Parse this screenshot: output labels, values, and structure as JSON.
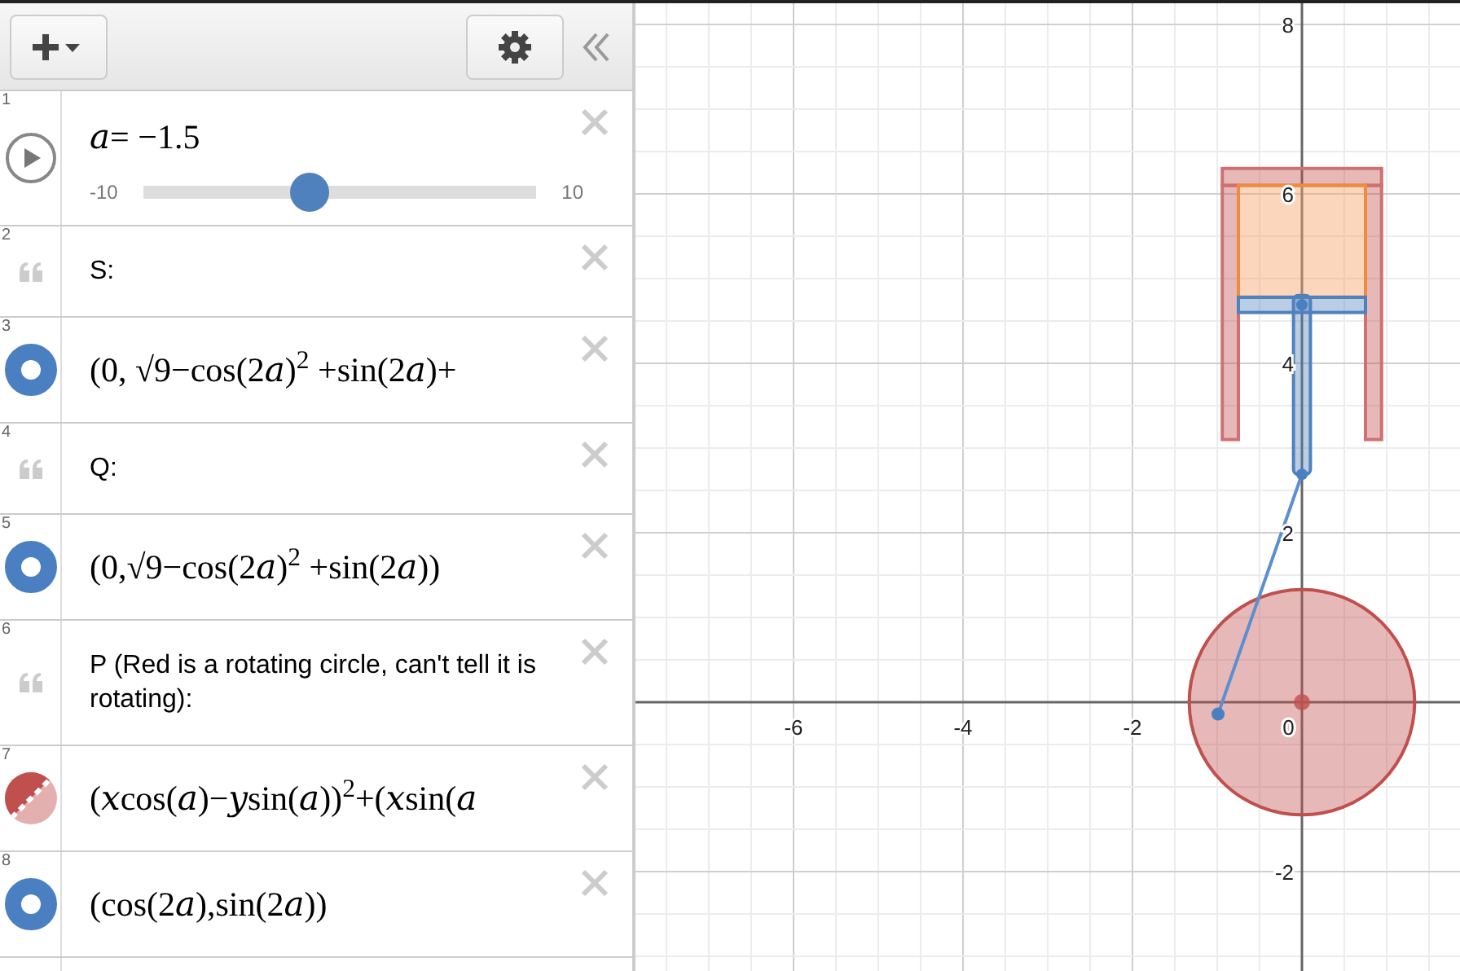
{
  "expressions": [
    {
      "number": "1",
      "kind": "slider",
      "latex": "𝑎= −1.5",
      "min": "-10",
      "max": "10",
      "level": 0.425
    },
    {
      "number": "2",
      "kind": "note",
      "text": "S:"
    },
    {
      "number": "3",
      "kind": "point",
      "color": "#4a7fc1",
      "latex": "(0, √9−cos(2𝑎)$^{2}$ +sin(2𝑎)+"
    },
    {
      "number": "4",
      "kind": "note",
      "text": "Q:"
    },
    {
      "number": "5",
      "kind": "point",
      "color": "#4a7fc1",
      "latex": "(0,√9−cos(2𝑎)$^{2}$ +sin(2𝑎))"
    },
    {
      "number": "6",
      "kind": "note",
      "text": "P (Red is a rotating circle, can't tell it is rotating):"
    },
    {
      "number": "7",
      "kind": "region",
      "color": "#c0504d",
      "latex": "(𝑥cos(𝑎)−𝑦sin(𝑎))$^{2}$+(𝑥sin(𝑎"
    },
    {
      "number": "8",
      "kind": "point",
      "color": "#4a7fc1",
      "latex": "(cos(2𝑎),sin(2𝑎))"
    }
  ],
  "graph": {
    "x_labels": [
      "-6",
      "-4",
      "-2",
      "0"
    ],
    "y_labels": [
      "8",
      "6",
      "4",
      "2",
      "-2"
    ]
  }
}
